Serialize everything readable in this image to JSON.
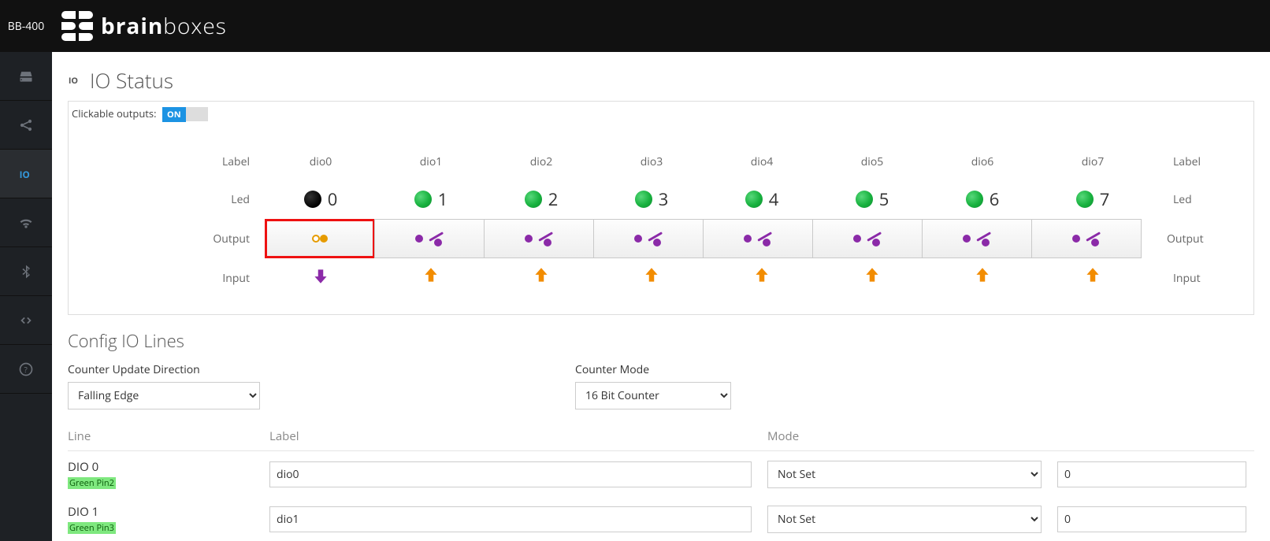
{
  "product": "BB-400",
  "brand": {
    "bold": "brain",
    "thin": "boxes"
  },
  "sidebar": {
    "items": [
      {
        "name": "disk",
        "active": false
      },
      {
        "name": "share",
        "active": false
      },
      {
        "name": "io",
        "active": true
      },
      {
        "name": "wifi",
        "active": false
      },
      {
        "name": "bluetooth",
        "active": false
      },
      {
        "name": "code",
        "active": false
      },
      {
        "name": "help",
        "active": false
      }
    ]
  },
  "page": {
    "title": "IO Status",
    "clickable_label": "Clickable outputs:",
    "clickable_state": "ON",
    "row_label_left": "Label",
    "row_led_left": "Led",
    "row_output_left": "Output",
    "row_input_left": "Input",
    "row_label_right": "Label",
    "row_led_right": "Led",
    "row_output_right": "Output",
    "row_input_right": "Input"
  },
  "io": [
    {
      "label": "dio0",
      "num": "0",
      "led": "off",
      "switch": "closed",
      "selected": true,
      "arrow": "down"
    },
    {
      "label": "dio1",
      "num": "1",
      "led": "on",
      "switch": "open",
      "selected": false,
      "arrow": "up"
    },
    {
      "label": "dio2",
      "num": "2",
      "led": "on",
      "switch": "open",
      "selected": false,
      "arrow": "up"
    },
    {
      "label": "dio3",
      "num": "3",
      "led": "on",
      "switch": "open",
      "selected": false,
      "arrow": "up"
    },
    {
      "label": "dio4",
      "num": "4",
      "led": "on",
      "switch": "open",
      "selected": false,
      "arrow": "up"
    },
    {
      "label": "dio5",
      "num": "5",
      "led": "on",
      "switch": "open",
      "selected": false,
      "arrow": "up"
    },
    {
      "label": "dio6",
      "num": "6",
      "led": "on",
      "switch": "open",
      "selected": false,
      "arrow": "up"
    },
    {
      "label": "dio7",
      "num": "7",
      "led": "on",
      "switch": "open",
      "selected": false,
      "arrow": "up"
    }
  ],
  "config": {
    "title": "Config IO Lines",
    "dir_label": "Counter Update Direction",
    "dir_value": "Falling Edge",
    "mode_label": "Counter Mode",
    "mode_value": "16 Bit Counter",
    "col_line": "Line",
    "col_label": "Label",
    "col_mode": "Mode",
    "rows": [
      {
        "line": "DIO 0",
        "pin": "Green Pin2",
        "label": "dio0",
        "mode": "Not Set",
        "count": "0"
      },
      {
        "line": "DIO 1",
        "pin": "Green Pin3",
        "label": "dio1",
        "mode": "Not Set",
        "count": "0"
      }
    ]
  }
}
